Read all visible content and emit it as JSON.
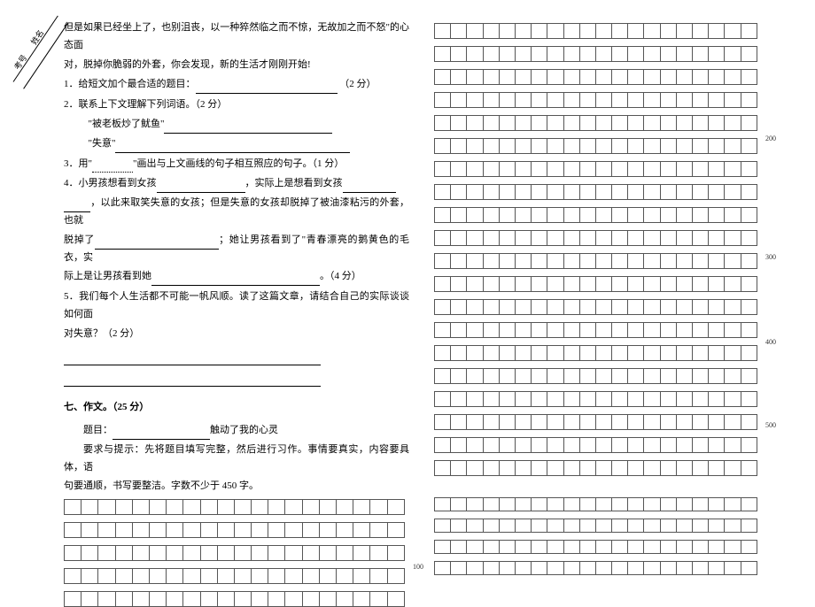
{
  "sideLabel1": "考号",
  "sideLabel2": "姓名",
  "passage": {
    "p1": "但是如果已经坐上了，也别沮丧，以一种猝然临之而不惊，无故加之而不怒\"的心态面",
    "p2": "对，脱掉你脆弱的外套，你会发现，新的生活才刚刚开始!"
  },
  "q1": {
    "label": "1．给短文加个最合适的题目：",
    "points": "（2 分）"
  },
  "q2": {
    "label": "2．联系上下文理解下列词语。（2 分）",
    "item1a": "\"被老板炒了鱿鱼\"",
    "item2a": "\"失意\""
  },
  "q3": {
    "label": "3．用\"",
    "label2": "\"画出与上文画线的句子相互照应的句子。（1 分）"
  },
  "q4": {
    "l1a": "4．小男孩想看到女孩",
    "l1b": "，实际上是想看到女孩",
    "l2a": "，以此来取笑失意的女孩；但是失意的女孩却脱掉了被油漆粘污的外套，也就",
    "l3a": "脱掉了",
    "l3b": "；她让男孩看到了\"青春漂亮的鹅黄色的毛衣，实",
    "l4a": "际上是让男孩看到她",
    "l4b": "。（4 分）"
  },
  "q5": {
    "l1": "5．我们每个人生活都不可能一帆风顺。读了这篇文章，请结合自己的实际谈谈如何面",
    "l2": "对失意？（2 分）"
  },
  "section7": {
    "title": "七、作文。（25 分）",
    "topic_prefix": "题目：",
    "topic_suffix": "触动了我的心灵",
    "req1": "要求与提示：先将题目填写完整，然后进行习作。事情要真实，内容要具体，语",
    "req2": "句要通顺，书写要整洁。字数不少于 450 字。"
  },
  "counts": {
    "c100": "100",
    "c200": "200",
    "c300": "300",
    "c400": "400",
    "c500": "500"
  }
}
